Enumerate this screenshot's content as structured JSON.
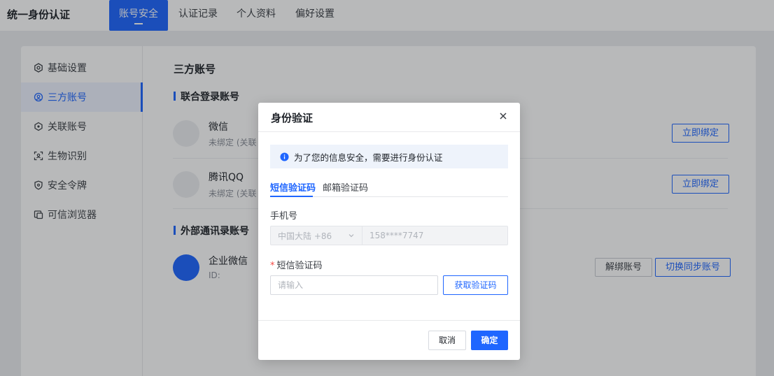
{
  "app": {
    "title": "统一身份认证"
  },
  "nav": {
    "tabs": [
      {
        "label": "账号安全",
        "active": true
      },
      {
        "label": "认证记录",
        "active": false
      },
      {
        "label": "个人资料",
        "active": false
      },
      {
        "label": "偏好设置",
        "active": false
      }
    ]
  },
  "sidebar": {
    "items": [
      {
        "label": "基础设置",
        "icon": "settings-icon"
      },
      {
        "label": "三方账号",
        "icon": "link-account-icon",
        "active": true
      },
      {
        "label": "关联账号",
        "icon": "associated-account-icon"
      },
      {
        "label": "生物识别",
        "icon": "biometric-icon"
      },
      {
        "label": "安全令牌",
        "icon": "shield-icon"
      },
      {
        "label": "可信浏览器",
        "icon": "browser-icon"
      }
    ]
  },
  "main": {
    "title": "三方账号",
    "federated_title": "联合登录账号",
    "federated_accounts": [
      {
        "name": "微信",
        "status": "未绑定 (关联",
        "action": "立即绑定"
      },
      {
        "name": "腾讯QQ",
        "status": "未绑定 (关联",
        "action": "立即绑定"
      }
    ],
    "external_title": "外部通讯录账号",
    "external_accounts": [
      {
        "name": "企业微信",
        "id_prefix": "ID: ",
        "actions": [
          "解绑账号",
          "切换同步账号"
        ]
      }
    ]
  },
  "modal": {
    "title": "身份验证",
    "notice": "为了您的信息安全，需要进行身份认证",
    "tabs": [
      {
        "label": "短信验证码",
        "active": true
      },
      {
        "label": "邮箱验证码",
        "active": false
      }
    ],
    "phone_label": "手机号",
    "region": "中国大陆 +86",
    "phone_value": "158****7747",
    "code_label": "短信验证码",
    "code_placeholder": "请输入",
    "get_code": "获取验证码",
    "cancel": "取消",
    "confirm": "确定"
  },
  "colors": {
    "accent": "#1f66ff",
    "required": "#f54a45"
  }
}
